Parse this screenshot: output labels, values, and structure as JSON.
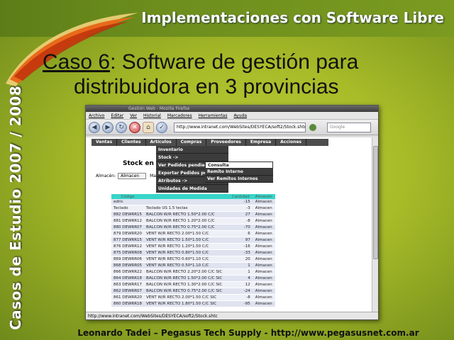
{
  "slide": {
    "header_title": "Implementaciones con Software Libre",
    "side_text": "Casos de Estudio 2007 / 2008",
    "case_word": "Caso 6",
    "case_rest": ":  Software de gestión para",
    "case_line2": "distribuidora en 3 provincias",
    "footer": "Leonardo Tadei – Pegasus Tech Supply - http://www.pegasusnet.com.ar"
  },
  "browser": {
    "window_title": "Gestión Web - Mozilla Firefox",
    "menu": [
      "Archivo",
      "Editar",
      "Ver",
      "Historial",
      "Marcadores",
      "Herramientas",
      "Ayuda"
    ],
    "url": "http://www.intranet.com/WebSites/DESYECA/soft2/Stock.shtc",
    "search_placeholder": "Google",
    "status": "http://www.intranet.com/WebSites/DESYECA/soft2/Stock.shtc"
  },
  "app": {
    "nav": [
      "Ventas",
      "Clientes",
      "Artículos",
      "Compras",
      "Proveedores",
      "Empresa",
      "Acciones"
    ],
    "dropdown": [
      "Inventario",
      "Stock ->",
      "Ver Pedidos pendientes",
      "Exportar Pedidos pe",
      "Atributos ->",
      "Unidades de Medida"
    ],
    "submenu": [
      "Consulta",
      "Remito Interno",
      "Ver Remitos Internos"
    ],
    "heading": "Stock en",
    "almacen_label": "Almacén:",
    "almacen_value": "Almacen",
    "mat_label": "Mat",
    "columns": [
      "Código",
      "",
      "Cantidad",
      "Almacén"
    ],
    "rows": [
      {
        "code": "edric",
        "desc": "",
        "qty": "-15",
        "alm": "Almacen"
      },
      {
        "code": "Teclado",
        "desc": "Teclado US 1.5 teclas",
        "qty": "-3",
        "alm": "Almacen"
      },
      {
        "code": "882 DEWRR15",
        "desc": "BALCON W/R RECTO 1.50*2.00 C/C",
        "qty": "27",
        "alm": "Almacen"
      },
      {
        "code": "881 DEWRR12",
        "desc": "BALCON W/R RECTO 1.20*2.00 C/C",
        "qty": "-8",
        "alm": "Almacen"
      },
      {
        "code": "880 DEWRR07",
        "desc": "BALCON W/R RECTO 0.75*2.00 C/C",
        "qty": "-70",
        "alm": "Almacen"
      },
      {
        "code": "879 DEWRR20",
        "desc": "VENT W/R RECTO 2.00*1.50 C/C",
        "qty": "6",
        "alm": "Almacen"
      },
      {
        "code": "877 DEWRR15",
        "desc": "VENT W/R RECTO 1.50*1.50 C/C",
        "qty": "97",
        "alm": "Almacen"
      },
      {
        "code": "876 DEWRR12",
        "desc": "VENT W/R RECTO 1.20*1.50 C/C",
        "qty": "-16",
        "alm": "Almacen"
      },
      {
        "code": "875 DEWRR08",
        "desc": "VENT W/R RECTO 0.80*1.50 C/C",
        "qty": "-33",
        "alm": "Almacen"
      },
      {
        "code": "869 DEWRR06",
        "desc": "VENT W/R RECTO 0.60*1.10 C/C",
        "qty": "20",
        "alm": "Almacen"
      },
      {
        "code": "868 DEWRR05",
        "desc": "VENT W/R RECTO 0.50*1.10 C/C",
        "qty": "1",
        "alm": "Almacen"
      },
      {
        "code": "866 DEWRR22",
        "desc": "BALCON W/R RECTO 2.20*2.00 C/C SIC",
        "qty": "1",
        "alm": "Almacen"
      },
      {
        "code": "864 DEWRR18",
        "desc": "BALCON W/R RECTO 1.50*2.00 C/C SIC",
        "qty": "4",
        "alm": "Almacen"
      },
      {
        "code": "863 DEWRR17",
        "desc": "BALCON W/R RECTO 1.30*2.00 C/C SIC",
        "qty": "12",
        "alm": "Almacen"
      },
      {
        "code": "862 DEWRR07",
        "desc": "BALCON W/R RECTO 0.75*2.00 C/C SIC",
        "qty": "-24",
        "alm": "Almacen"
      },
      {
        "code": "861 DEWRR20",
        "desc": "VENT W/R RECTO 2.00*1.50 C/C SIC",
        "qty": "-8",
        "alm": "Almacen"
      },
      {
        "code": "860 DEWRR18",
        "desc": "VENT W/R RECTO 1.80*1.50 C/C SIC",
        "qty": "-95",
        "alm": "Almacen"
      }
    ]
  }
}
